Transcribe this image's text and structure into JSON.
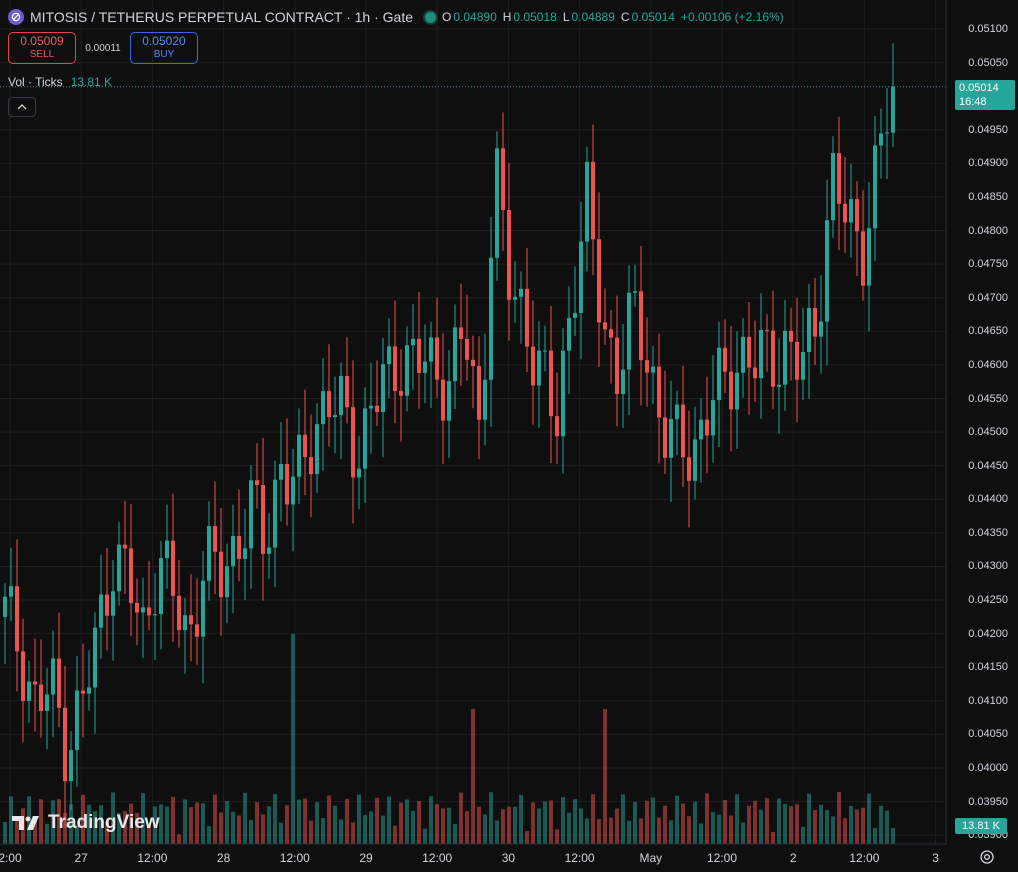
{
  "header": {
    "title": "MITOSIS / TETHERUS PERPETUAL CONTRACT · 1h · Gate",
    "ohlc": {
      "o_label": "O",
      "o_value": "0.04890",
      "h_label": "H",
      "h_value": "0.05018",
      "l_label": "L",
      "l_value": "0.04889",
      "c_label": "C",
      "c_value": "0.05014",
      "change": "+0.00106 (+2.16%)"
    }
  },
  "trade": {
    "sell_price": "0.05009",
    "sell_label": "SELL",
    "spread": "0.00011",
    "buy_price": "0.05020",
    "buy_label": "BUY"
  },
  "volume_legend": {
    "label": "Vol · Ticks",
    "value": "13.81 K"
  },
  "collapse_icon": "chevron-up-icon",
  "price_axis": {
    "ticks": [
      "0.05100",
      "0.05050",
      "0.04950",
      "0.04900",
      "0.04850",
      "0.04800",
      "0.04750",
      "0.04700",
      "0.04650",
      "0.04600",
      "0.04550",
      "0.04500",
      "0.04450",
      "0.04400",
      "0.04350",
      "0.04300",
      "0.04250",
      "0.04200",
      "0.04150",
      "0.04100",
      "0.04050",
      "0.04000",
      "0.03950",
      "0.03900"
    ],
    "last_price": "0.05014",
    "countdown": "16:48",
    "volume_label": "13.81 K"
  },
  "time_axis": {
    "labels": [
      "2:00",
      "27",
      "12:00",
      "28",
      "12:00",
      "29",
      "12:00",
      "30",
      "12:00",
      "May",
      "12:00",
      "2",
      "12:00",
      "3"
    ]
  },
  "watermark": "TradingView",
  "colors": {
    "up": "#26a69a",
    "down": "#ef5350",
    "background": "#0f0f0f",
    "grid": "#1f1f1f"
  },
  "chart_data": {
    "type": "candlestick",
    "symbol": "MITOSIS / TETHERUS PERPETUAL CONTRACT",
    "interval": "1h",
    "exchange": "Gate",
    "ylim": [
      0.0389,
      0.0512
    ],
    "x": [
      "Apr 26 12:00",
      "Apr 27",
      "Apr 27 12:00",
      "Apr 28",
      "Apr 28 12:00",
      "Apr 29",
      "Apr 29 12:00",
      "Apr 30",
      "Apr 30 12:00",
      "May",
      "May 1 12:00",
      "May 2",
      "May 2 12:00",
      "May 3"
    ],
    "close_path": [
      0.0423,
      0.0418,
      0.0409,
      0.0412,
      0.0404,
      0.0409,
      0.0419,
      0.0432,
      0.0428,
      0.042,
      0.0432,
      0.0425,
      0.0419,
      0.0431,
      0.0428,
      0.0433,
      0.0439,
      0.0433,
      0.0446,
      0.0441,
      0.0449,
      0.0456,
      0.0452,
      0.0447,
      0.0455,
      0.0457,
      0.0462,
      0.0461,
      0.0458,
      0.0459,
      0.0465,
      0.0449,
      0.0491,
      0.047,
      0.0467,
      0.0459,
      0.045,
      0.0471,
      0.0484,
      0.0466,
      0.046,
      0.0467,
      0.0461,
      0.0451,
      0.0447,
      0.0448,
      0.0454,
      0.0457,
      0.0462,
      0.046,
      0.0461,
      0.0463,
      0.0459,
      0.0467,
      0.0488,
      0.0481,
      0.0478,
      0.049,
      0.0501
    ],
    "volume": {
      "last": 13810,
      "spike_index": 48
    }
  }
}
